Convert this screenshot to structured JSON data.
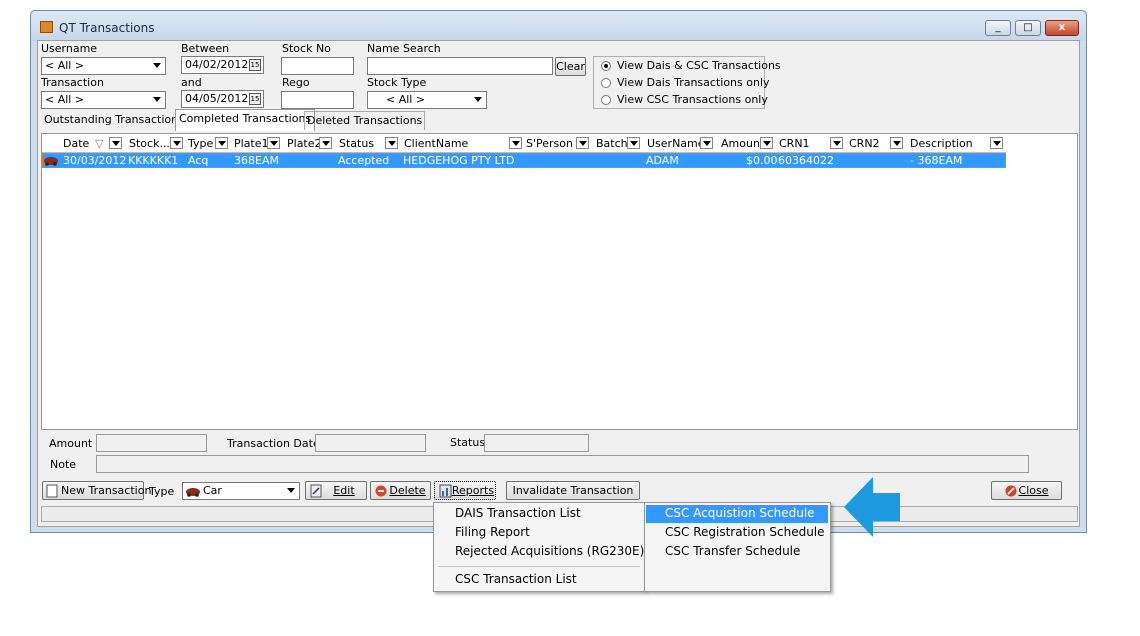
{
  "window": {
    "title": "QT Transactions",
    "minimize_glyph": "_",
    "maximize_glyph": "□",
    "close_glyph": "x"
  },
  "filters": {
    "username_label": "Username",
    "username_value": "< All >",
    "between_label": "Between",
    "from_date": "04/02/2012",
    "and_label": "and",
    "to_date": "04/05/2012",
    "calendar_glyph": "15",
    "stock_no_label": "Stock No",
    "stock_no_value": "",
    "name_search_label": "Name Search",
    "name_search_value": "",
    "clear_label": "Clear",
    "transaction_label": "Transaction",
    "transaction_value": "< All >",
    "rego_label": "Rego",
    "rego_value": "",
    "stock_type_label": "Stock Type",
    "stock_type_value": "< All >",
    "radios": [
      {
        "label": "View Dais & CSC Transactions",
        "selected": true
      },
      {
        "label": "View Dais Transactions only",
        "selected": false
      },
      {
        "label": "View CSC Transactions only",
        "selected": false
      }
    ]
  },
  "tabs": [
    "Outstanding Transactions",
    "Completed Transactions",
    "Deleted Transactions"
  ],
  "active_tab": "Completed Transactions",
  "grid": {
    "columns": [
      "Date",
      "Stock...",
      "Type",
      "Plate1",
      "Plate2",
      "Status",
      "ClientName",
      "S'Person",
      "Batch",
      "UserName",
      "Amount",
      "CRN1",
      "CRN2",
      "Description"
    ],
    "sort_glyph": "▽",
    "rows": [
      {
        "date": "30/03/2012",
        "stock": "KKKKKK1",
        "type": "Acq",
        "plate1": "368EAM",
        "plate2": "",
        "status": "Accepted",
        "client": "HEDGEHOG PTY LTD",
        "sperson": "",
        "batch": "",
        "user": "ADAM",
        "amount": "$0.00",
        "crn1": "60364022",
        "crn2": "",
        "description": "- 368EAM"
      }
    ]
  },
  "details": {
    "amount_label": "Amount",
    "amount_value": "",
    "transaction_date_label": "Transaction Date",
    "transaction_date_value": "",
    "status_label": "Status",
    "status_value": "",
    "note_label": "Note",
    "note_value": ""
  },
  "toolbar": {
    "new_transaction": "New Transaction",
    "type_label": "Type",
    "type_value": "Car",
    "edit": "Edit",
    "delete": "Delete",
    "reports": "Reports",
    "invalidate": "Invalidate Transaction",
    "close": "Close"
  },
  "reports_menu": {
    "items": [
      "DAIS Transaction List",
      "Filing Report",
      "Rejected Acquisitions (RG230E)"
    ],
    "footer_item": "CSC Transaction List",
    "submenu": [
      "CSC Acquistion Schedule",
      "CSC Registration Schedule",
      "CSC Transfer Schedule"
    ],
    "highlighted_submenu_index": 0
  },
  "colors": {
    "selection": "#3399ff",
    "arrow": "#1e9be0",
    "accent_border": "#e07d1a"
  },
  "icons": [
    "car-icon",
    "new-document-icon",
    "edit-icon",
    "delete-icon",
    "reports-icon",
    "close-icon",
    "calendar-icon",
    "pointer-arrow-icon"
  ]
}
